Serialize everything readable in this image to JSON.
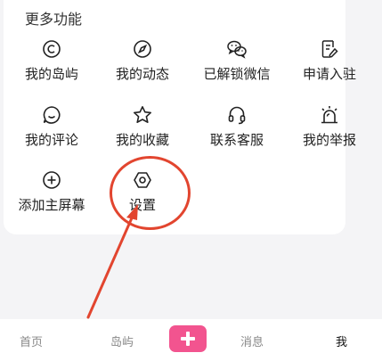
{
  "section": {
    "title": "更多功能"
  },
  "functions": [
    {
      "label": "我的岛屿",
      "icon": "copyright-circle-icon"
    },
    {
      "label": "我的动态",
      "icon": "compass-icon"
    },
    {
      "label": "已解锁微信",
      "icon": "wechat-icon"
    },
    {
      "label": "申请入驻",
      "icon": "edit-document-icon"
    },
    {
      "label": "我的评论",
      "icon": "chat-bubble-icon"
    },
    {
      "label": "我的收藏",
      "icon": "star-icon"
    },
    {
      "label": "联系客服",
      "icon": "headset-icon"
    },
    {
      "label": "我的举报",
      "icon": "alarm-icon"
    },
    {
      "label": "添加主屏幕",
      "icon": "plus-circle-icon"
    },
    {
      "label": "设置",
      "icon": "gear-hexagon-icon"
    }
  ],
  "nav": {
    "home": "首页",
    "island": "岛屿",
    "messages": "消息",
    "me": "我"
  },
  "colors": {
    "accent": "#f2548f",
    "annotation": "#e2452f"
  }
}
